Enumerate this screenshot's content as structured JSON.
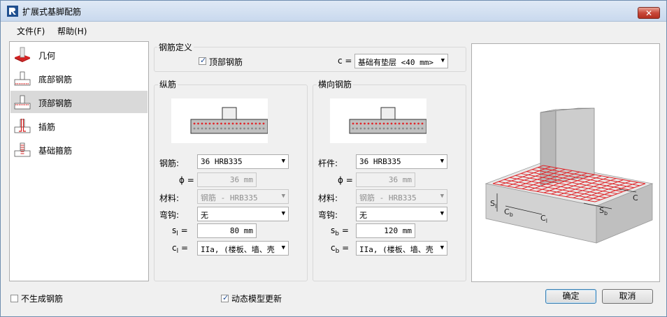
{
  "window": {
    "title": "扩展式基脚配筋",
    "close_label": "✕"
  },
  "menu": {
    "file": "文件(F)",
    "help": "帮助(H)"
  },
  "nav": {
    "items": [
      {
        "label": "几何",
        "icon": "geometry-icon"
      },
      {
        "label": "底部钢筋",
        "icon": "bottom-rebar-icon"
      },
      {
        "label": "顶部钢筋",
        "icon": "top-rebar-icon",
        "selected": true
      },
      {
        "label": "插筋",
        "icon": "dowel-icon"
      },
      {
        "label": "基础箍筋",
        "icon": "stirrup-icon"
      }
    ]
  },
  "rebar_def": {
    "title": "钢筋定义",
    "top_rebar_label": "顶部钢筋",
    "top_rebar_checked": true,
    "c_label": "c =",
    "c_value": "基础有垫层 <40 mm>"
  },
  "longitudinal": {
    "title": "纵筋",
    "rebar_label": "钢筋:",
    "rebar_value": "36 HRB335",
    "phi_label": "ϕ =",
    "phi_value": "36 mm",
    "material_label": "材料:",
    "material_value": "钢筋 - HRB335",
    "hook_label": "弯钩:",
    "hook_value": "无",
    "s_label": "s",
    "s_sub": "l",
    "s_eq": "=",
    "s_value": "80 mm",
    "c_label": "c",
    "c_sub": "l",
    "c_eq": "=",
    "c_value": "IIa, (楼板、墙、壳"
  },
  "transverse": {
    "title": "横向钢筋",
    "rebar_label": "杆件:",
    "rebar_value": "36 HRB335",
    "phi_label": "ϕ =",
    "phi_value": "36 mm",
    "material_label": "材料:",
    "material_value": "钢筋 - HRB335",
    "hook_label": "弯钩:",
    "hook_value": "无",
    "s_label": "s",
    "s_sub": "b",
    "s_eq": "=",
    "s_value": "120 mm",
    "c_label": "c",
    "c_sub": "b",
    "c_eq": "=",
    "c_value": "IIa, (楼板、墙、壳"
  },
  "preview": {
    "labels": {
      "s_l": "S",
      "s_l_sub": "l",
      "c_b": "C",
      "c_b_sub": "b",
      "c_l": "C",
      "c_l_sub": "l",
      "s_b": "S",
      "s_b_sub": "b",
      "c": "C"
    },
    "rebar_color": "#e0262a"
  },
  "footer": {
    "no_rebar_label": "不生成钢筋",
    "no_rebar_checked": false,
    "dynamic_update_label": "动态模型更新",
    "dynamic_update_checked": true,
    "ok_label": "确定",
    "cancel_label": "取消"
  }
}
